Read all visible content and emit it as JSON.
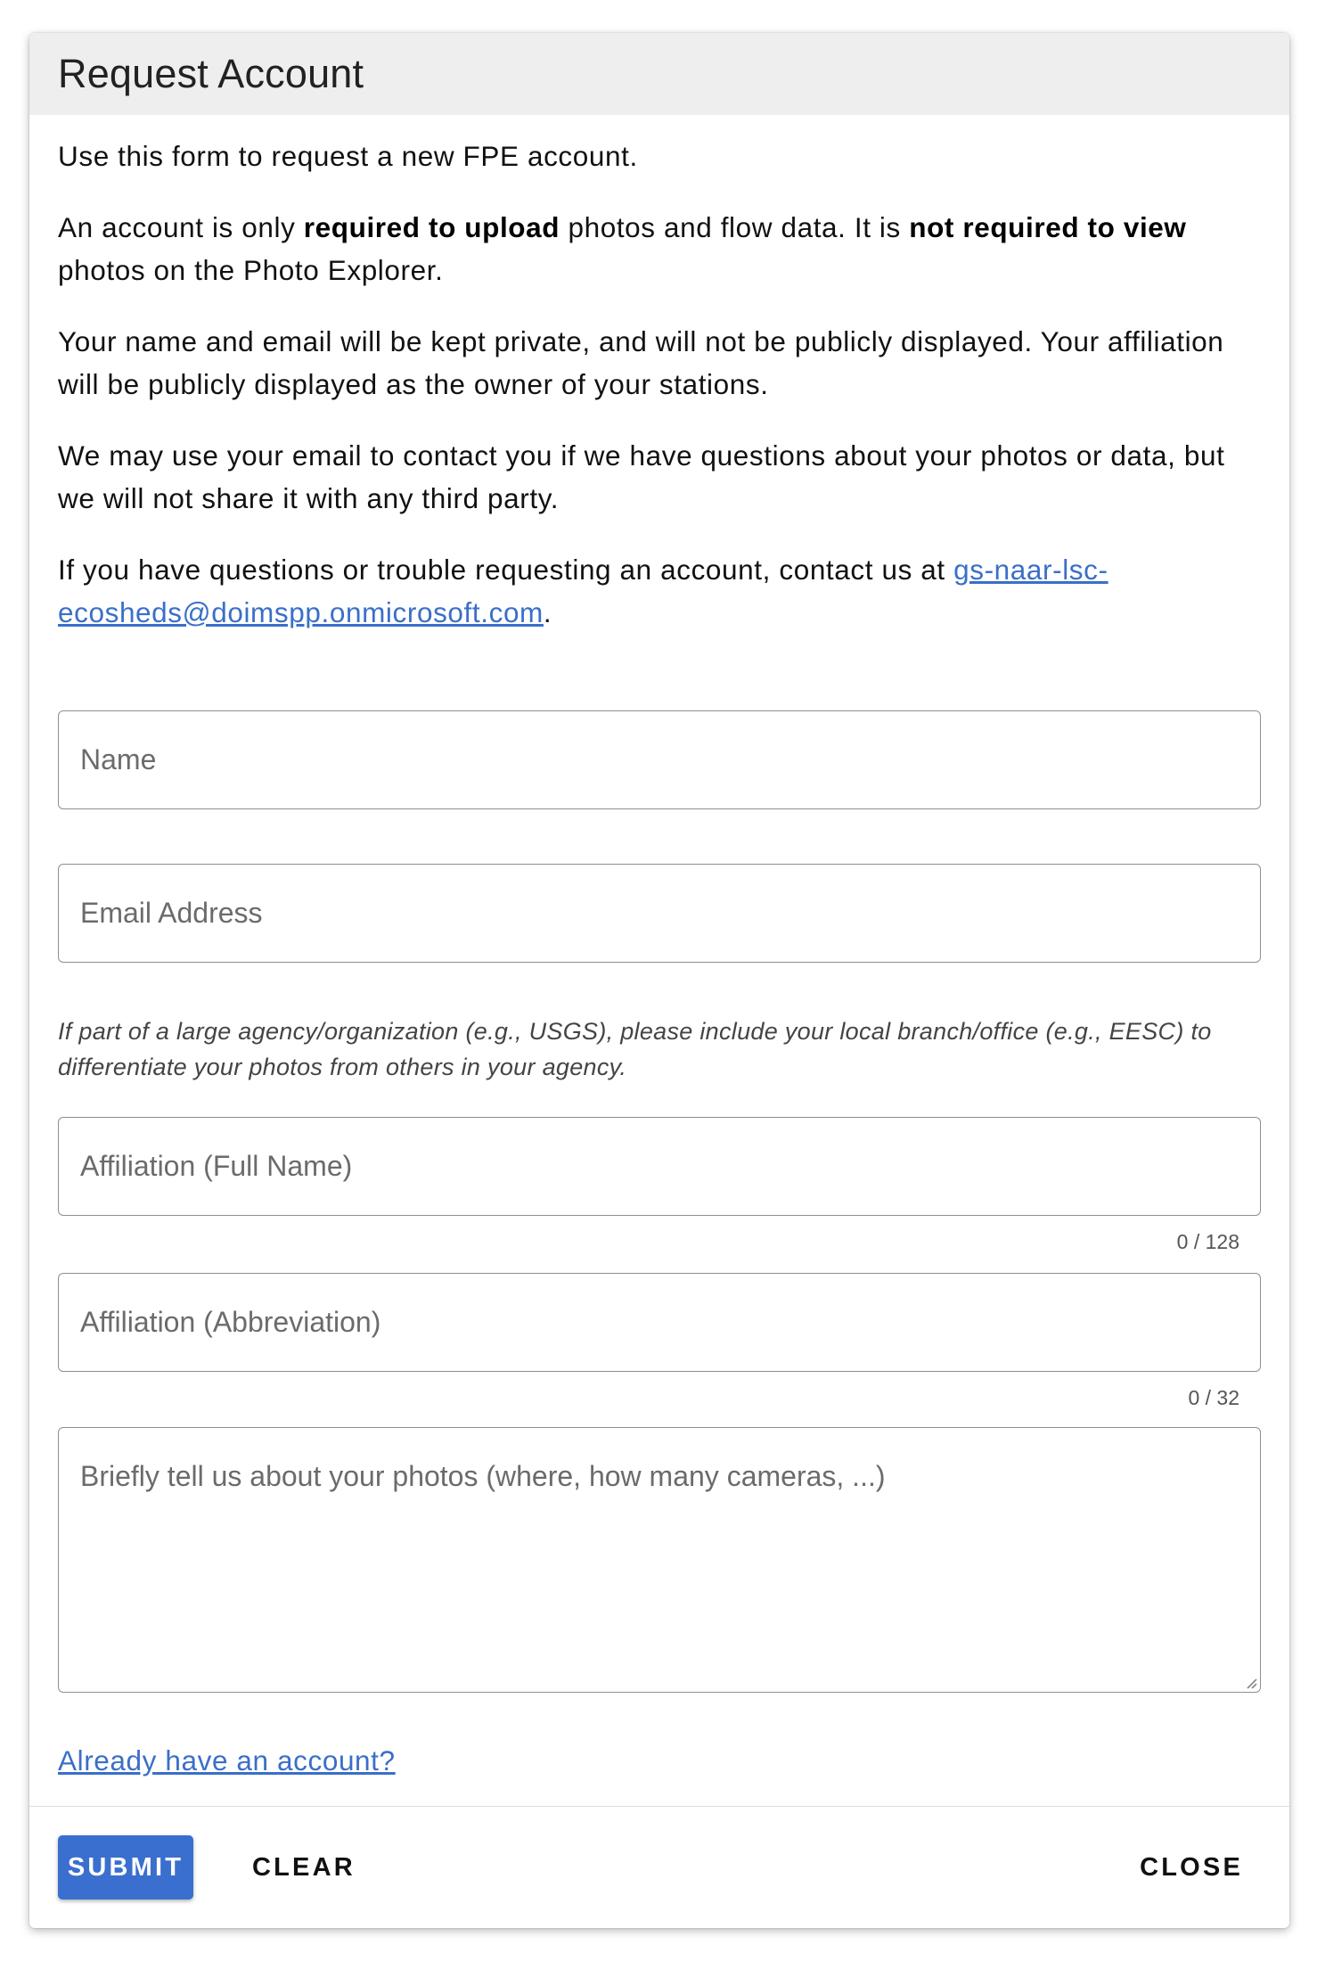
{
  "dialog": {
    "title": "Request Account"
  },
  "intro": {
    "p1": "Use this form to request a new FPE account.",
    "p2": {
      "part1": "An account is only ",
      "bold1": "required to upload",
      "part2": " photos and flow data. It is ",
      "bold2": "not required to view",
      "part3": " photos on the Photo Explorer."
    },
    "p3": "Your name and email will be kept private, and will not be publicly displayed. Your affiliation will be publicly displayed as the owner of your stations.",
    "p4": "We may use your email to contact you if we have questions about your photos or data, but we will not share it with any third party.",
    "p5": {
      "text": "If you have questions or trouble requesting an account, contact us at ",
      "email": "gs-naar-lsc-ecosheds@doimspp.onmicrosoft.com",
      "end": "."
    }
  },
  "form": {
    "name": {
      "placeholder": "Name",
      "value": ""
    },
    "email": {
      "placeholder": "Email Address",
      "value": ""
    },
    "affiliation_hint": "If part of a large agency/organization (e.g., USGS), please include your local branch/office (e.g., EESC) to differentiate your photos from others in your agency.",
    "affiliation_full": {
      "placeholder": "Affiliation (Full Name)",
      "value": "",
      "counter": "0 / 128"
    },
    "affiliation_abbr": {
      "placeholder": "Affiliation (Abbreviation)",
      "value": "",
      "counter": "0 / 32"
    },
    "description": {
      "placeholder": "Briefly tell us about your photos (where, how many cameras, ...)",
      "value": ""
    },
    "login_link": "Already have an account?"
  },
  "footer": {
    "submit": "Submit",
    "clear": "Clear",
    "close": "Close"
  },
  "colors": {
    "accent": "#3a6fd0",
    "link": "#3a6fc9",
    "header_bg": "#eeeeee"
  }
}
